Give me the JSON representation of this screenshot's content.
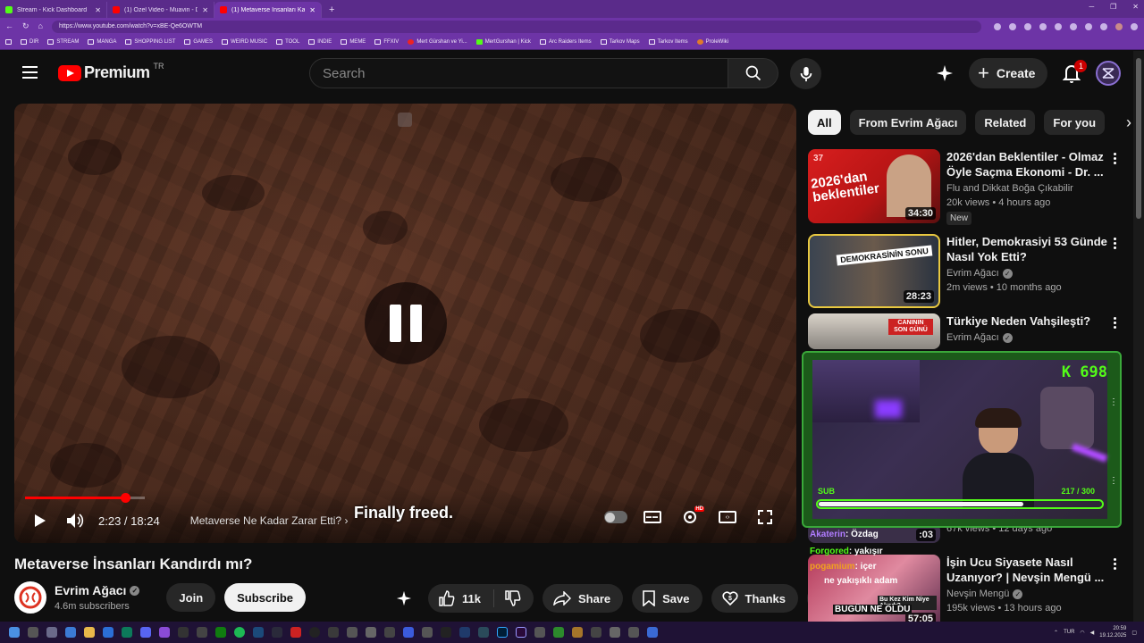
{
  "browser": {
    "tabs": [
      {
        "title": "Stream - Kick Dashboard",
        "color": "#53fc18"
      },
      {
        "title": "(1) Özel Video - Muavin - Dinleme",
        "color": "#ff0000"
      },
      {
        "title": "(1) Metaverse İnsanları Kandır",
        "color": "#ff0000",
        "active": true
      }
    ],
    "new_tab": "+",
    "url": "https://www.youtube.com/watch?v=xBE-Qe6OWTM",
    "bookmarks": [
      {
        "label": "DIR"
      },
      {
        "label": "STREAM"
      },
      {
        "label": "MANGA"
      },
      {
        "label": "SHOPPING LIST"
      },
      {
        "label": "GAMES"
      },
      {
        "label": "WEIRD MUSIC"
      },
      {
        "label": "TOOL"
      },
      {
        "label": "INDIE"
      },
      {
        "label": "MEME"
      },
      {
        "label": "FFXIV"
      },
      {
        "label": "Mert Gürshan ve Yi..."
      },
      {
        "label": "MertGurshan | Kick"
      },
      {
        "label": "Arc Raiders Items"
      },
      {
        "label": "Tarkov Maps"
      },
      {
        "label": "Tarkov Items"
      },
      {
        "label": "ProleWiki"
      }
    ]
  },
  "header": {
    "logo_text": "Premium",
    "country": "TR",
    "search_placeholder": "Search",
    "create_label": "Create",
    "notif_count": "1"
  },
  "player": {
    "time_current": "2:23",
    "time_sep": " / ",
    "time_total": "18:24",
    "chapter": "Metaverse Ne Kadar Zarar Etti?",
    "chapter_arrow": "›",
    "subtitle": "Finally freed.",
    "hd_badge": "HD",
    "played_fraction": 0.13,
    "buffered_fraction": 0.155
  },
  "video": {
    "title": "Metaverse İnsanları Kandırdı mı?",
    "channel": "Evrim Ağacı",
    "subscribers": "4.6m subscribers",
    "join": "Join",
    "subscribe": "Subscribe",
    "likes": "11k",
    "share": "Share",
    "save": "Save",
    "thanks": "Thanks"
  },
  "sidebar": {
    "chips": [
      "All",
      "From Evrim Ağacı",
      "Related",
      "For you"
    ],
    "recs": [
      {
        "title": "2026'dan Beklentiler - Olmaz Öyle Saçma Ekonomi - Dr. ...",
        "channel": "Flu and Dikkat Boğa Çıkabilir",
        "meta": "20k views • 4 hours ago",
        "duration": "34:30",
        "badge": "New",
        "thumb_text": "2026'dan beklentiler",
        "thumb_num": "37"
      },
      {
        "title": "Hitler, Demokrasiyi 53 Günde Nasıl Yok Etti?",
        "channel": "Evrim Ağacı",
        "meta": "2m views • 10 months ago",
        "duration": "28:23",
        "thumb_text": "DEMOKRASİNİN SONU"
      },
      {
        "title": "Türkiye Neden Vahşileşti?",
        "channel": "Evrim Ağacı",
        "thumb_text": "CANININ SON GÜNÜ"
      },
      {
        "meta": "67k views • 12 days ago",
        "duration": ":03"
      },
      {
        "title": "İşin Ucu Siyasete Nasıl Uzanıyor? | Nevşin Mengü ...",
        "channel": "Nevşin Mengü",
        "meta": "195k views • 13 hours ago",
        "duration": "57:05",
        "thumb_text": "Bu Kez Kim Niye Alındı?"
      }
    ]
  },
  "stream_overlay": {
    "kick_count": "K 698",
    "sub_label": "SUB",
    "sub_count": "217 / 300",
    "sub_fraction": 0.7233,
    "chat": [
      {
        "user": "Akaterin",
        "text": ": Özdag"
      },
      {
        "user": "Forgored",
        "text": ": yakışır"
      },
      {
        "user": "pogamium",
        "text": ": içer"
      },
      {
        "user": "",
        "text": "ne yakışıklı adam"
      },
      {
        "user": "",
        "text": "BUGÜN NE OLDU"
      }
    ]
  },
  "taskbar": {
    "lang": "TUR",
    "time": "20:59",
    "date": "19.12.2025"
  },
  "colors": {
    "browser_frame": "#6d34a6",
    "yt_red": "#ff0000",
    "kick_green": "#53fc18"
  }
}
